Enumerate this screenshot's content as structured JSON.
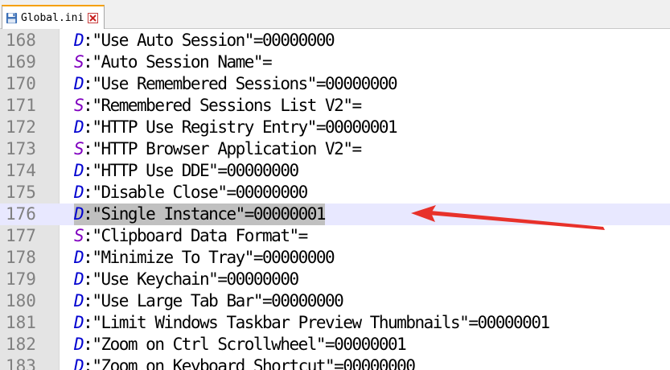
{
  "tab": {
    "label": "Global.ini",
    "icon": "save-disk-icon",
    "close_icon": "close-icon"
  },
  "colors": {
    "prefix_d": "#0000d0",
    "prefix_s": "#8000c0",
    "current_line": "#e8e8ff",
    "selection": "#c0c0c0",
    "arrow": "#e8312a",
    "tab_accent": "#f5a000"
  },
  "lines": [
    {
      "num": "168",
      "prefix": "D",
      "text": "\"Use Auto Session\"=00000000"
    },
    {
      "num": "169",
      "prefix": "S",
      "text": "\"Auto Session Name\"="
    },
    {
      "num": "170",
      "prefix": "D",
      "text": "\"Use Remembered Sessions\"=00000000"
    },
    {
      "num": "171",
      "prefix": "S",
      "text": "\"Remembered Sessions List V2\"="
    },
    {
      "num": "172",
      "prefix": "D",
      "text": "\"HTTP Use Registry Entry\"=00000001"
    },
    {
      "num": "173",
      "prefix": "S",
      "text": "\"HTTP Browser Application V2\"="
    },
    {
      "num": "174",
      "prefix": "D",
      "text": "\"HTTP Use DDE\"=00000000"
    },
    {
      "num": "175",
      "prefix": "D",
      "text": "\"Disable Close\"=00000000"
    },
    {
      "num": "176",
      "prefix": "D",
      "text": "\"Single Instance\"=00000001",
      "current": true
    },
    {
      "num": "177",
      "prefix": "S",
      "text": "\"Clipboard Data Format\"="
    },
    {
      "num": "178",
      "prefix": "D",
      "text": "\"Minimize To Tray\"=00000000"
    },
    {
      "num": "179",
      "prefix": "D",
      "text": "\"Use Keychain\"=00000000"
    },
    {
      "num": "180",
      "prefix": "D",
      "text": "\"Use Large Tab Bar\"=00000000"
    },
    {
      "num": "181",
      "prefix": "D",
      "text": "\"Limit Windows Taskbar Preview Thumbnails\"=00000001"
    },
    {
      "num": "182",
      "prefix": "D",
      "text": "\"Zoom on Ctrl Scrollwheel\"=00000001"
    },
    {
      "num": "183",
      "prefix": "D",
      "text": "\"Zoom on Keyboard Shortcut\"=00000000"
    }
  ]
}
